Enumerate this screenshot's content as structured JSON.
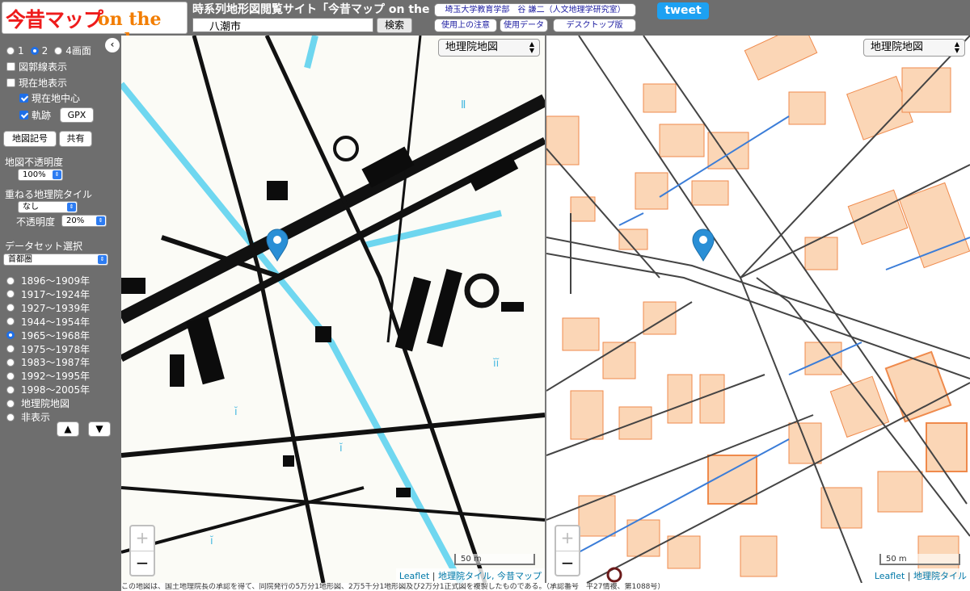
{
  "header": {
    "logo_text_1": "今昔マップ",
    "logo_text_2": "on the web",
    "site_title": "時系列地形図閲覧サイト「今昔マップ on the web」",
    "search_value": "八潮市",
    "search_button": "検索",
    "links": [
      "埼玉大学教育学部　谷 謙二（人文地理学研究室）",
      "使用上の注意",
      "使用データ",
      "デスクトップ版"
    ],
    "tweet_label": "tweet"
  },
  "sidebar": {
    "collapse_icon": "chevron-left-icon",
    "screen_options": [
      "1",
      "2",
      "4画面"
    ],
    "screen_selected": "2",
    "checkboxes": [
      {
        "label": "図郭線表示",
        "checked": false
      },
      {
        "label": "現在地表示",
        "checked": false
      },
      {
        "label": "現在地中心",
        "checked": true
      },
      {
        "label": "軌跡",
        "checked": true
      }
    ],
    "gpx_button": "GPX",
    "map_symbols_button": "地図記号",
    "share_button": "共有",
    "opacity_label": "地図不透明度",
    "opacity_value": "100%",
    "overlay_label": "重ねる地理院タイル",
    "overlay_value": "なし",
    "overlay_opacity_label": "不透明度",
    "overlay_opacity_value": "20%",
    "dataset_label": "データセット選択",
    "dataset_value": "首都圏",
    "periods": [
      "1896〜1909年",
      "1917〜1924年",
      "1927〜1939年",
      "1944〜1954年",
      "1965〜1968年",
      "1975〜1978年",
      "1983〜1987年",
      "1992〜1995年",
      "1998〜2005年",
      "地理院地図",
      "非表示"
    ],
    "period_selected": "1965〜1968年",
    "up_button": "▲",
    "down_button": "▼"
  },
  "map_left": {
    "layer_select": "地理院地図",
    "scale_label": "50 m",
    "attribution": {
      "leaflet": "Leaflet",
      "sep": "|",
      "source": "地理院タイル, 今昔マップ"
    },
    "zoom_in": "+",
    "zoom_out": "−"
  },
  "map_right": {
    "layer_select": "地理院地図",
    "scale_label": "50 m",
    "attribution": {
      "leaflet": "Leaflet",
      "sep": "|",
      "source": "地理院タイル"
    },
    "zoom_in": "+",
    "zoom_out": "−"
  },
  "footer": {
    "text": "この地図は、国土地理院長の承認を得て、同院発行の5万分1地形図、2万5千分1地形図及び2万分1正式図を複製したものである。（承認番号　平27情複、第1088号）"
  },
  "colors": {
    "accent": "#1e6fe8",
    "tweet": "#1da1f2",
    "building": "#f9d3b3",
    "building_stroke": "#ef7a38",
    "water": "#3b7dd8",
    "marker": "#2a8fd6"
  }
}
